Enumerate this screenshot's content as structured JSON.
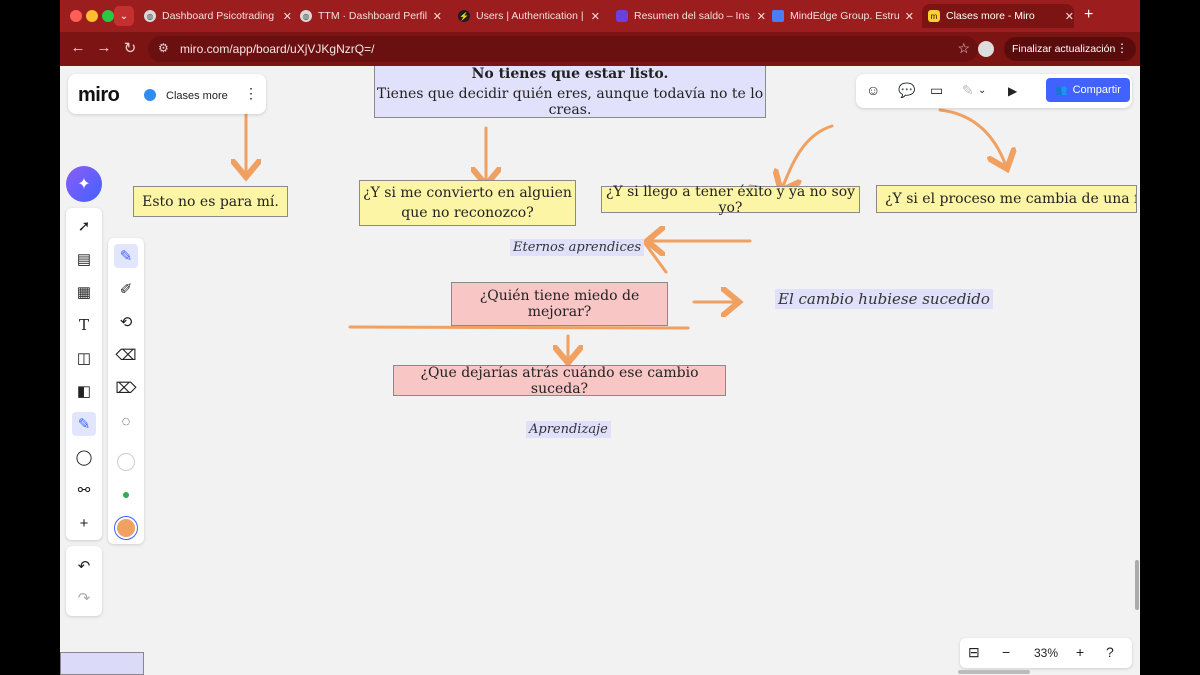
{
  "browser": {
    "tabs": [
      {
        "label": "Dashboard Psicotrading",
        "active": false
      },
      {
        "label": "TTM · Dashboard Perfile",
        "active": false
      },
      {
        "label": "Users | Authentication |",
        "active": false
      },
      {
        "label": "Resumen del saldo – Ins",
        "active": false
      },
      {
        "label": "MindEdge Group. Estruc",
        "active": false
      },
      {
        "label": "Clases more - Miro",
        "active": true
      }
    ],
    "new_tab": "+",
    "url": "miro.com/app/board/uXjVJKgNzrQ=/",
    "update_button": "Finalizar actualización"
  },
  "miro": {
    "logo": "miro",
    "board_name": "Clases more",
    "share_button": "Compartir",
    "zoom_level": "33%"
  },
  "board": {
    "header_note": {
      "title": "No tienes que estar listo.",
      "body": "Tienes que decidir quién eres, aunque todavía no te lo creas."
    },
    "notes": {
      "n1": "Esto no es para mí.",
      "n2": "¿Y si me convierto en alguien que no reconozco?",
      "n3": "¿Y si llego a tener éxito y ya no soy yo?",
      "n4": "¿Y si el proceso me cambia de una forma",
      "n5": "¿Quién tiene miedo de mejorar?",
      "n6": "¿Que dejarías atrás cuándo ese cambio suceda?"
    },
    "handwritten": {
      "h1": "Eternos aprendices",
      "h2": "El cambio hubiese sucedido",
      "h3": "Aprendizaje"
    }
  },
  "colors": {
    "browser_frame": "#9c1d1d",
    "arrow": "#f0a060",
    "sticky_yellow": "#fdf5a6",
    "sticky_pink": "#f9c6c6",
    "lavender": "#e2e1fb",
    "share_blue": "#4262ff"
  }
}
